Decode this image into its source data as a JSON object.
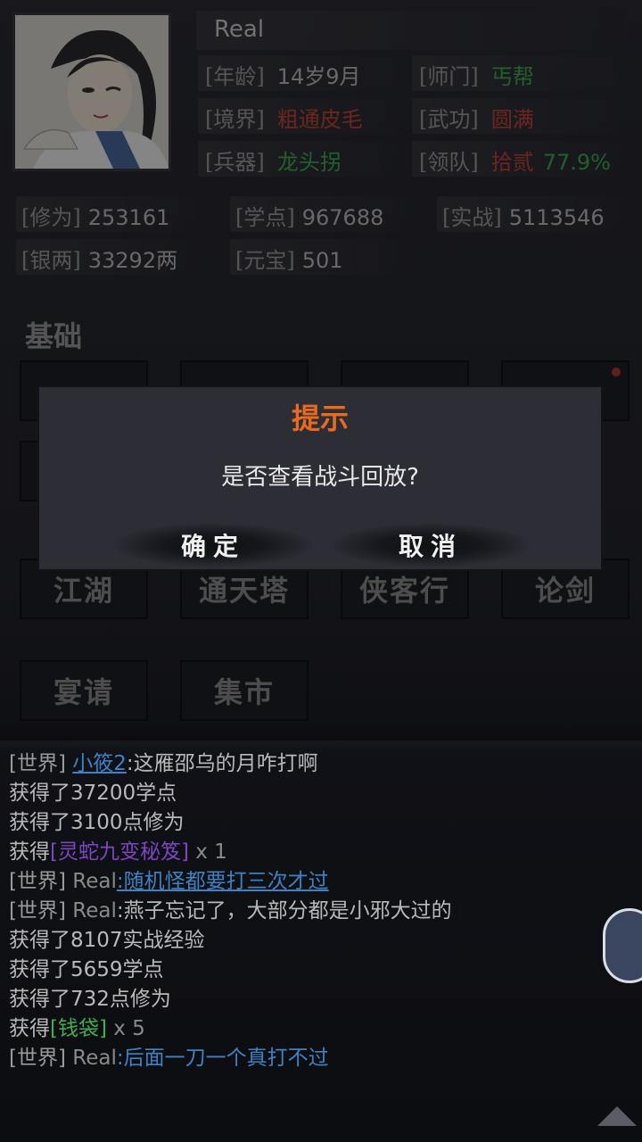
{
  "player": {
    "name": "Real",
    "age_label": "[年龄]",
    "age": "14岁9月",
    "sect_label": "[师门]",
    "sect": "丐帮",
    "realm_label": "[境界]",
    "realm": "粗通皮毛",
    "martial_label": "[武功]",
    "martial": "圆满",
    "weapon_label": "[兵器]",
    "weapon": "龙头拐",
    "lead_label": "[领队]",
    "lead": "拾贰",
    "lead_pct": "77.9%"
  },
  "resources": {
    "cultivation_label": "[修为]",
    "cultivation": "253161",
    "learn_label": "[学点]",
    "learn": "967688",
    "combat_label": "[实战]",
    "combat": "5113546",
    "silver_label": "[银两]",
    "silver": "33292两",
    "ingot_label": "[元宝]",
    "ingot": "501"
  },
  "sections": {
    "basic": "基础"
  },
  "menu": {
    "jianghu": "江湖",
    "tower": "通天塔",
    "xiakexing": "侠客行",
    "lunjian": "论剑",
    "banquet": "宴请",
    "market": "集市"
  },
  "dialog": {
    "title": "提示",
    "message": "是否查看战斗回放?",
    "confirm": "确定",
    "cancel": "取消"
  },
  "log": [
    {
      "tag": "[世界]",
      "user": "小筱2",
      "text": ":这雁邵乌的月咋打啊"
    },
    {
      "text": "获得了37200学点"
    },
    {
      "text": "获得了3100点修为"
    },
    {
      "prefix": "获得",
      "item": "[灵蛇九变秘笈]",
      "count": " x 1"
    },
    {
      "tag": "[世界]",
      "user": "Real",
      "text": ":随机怪都要打三次才过"
    },
    {
      "tag": "[世界]",
      "user": "Real",
      "text": ":燕子忘记了，大部分都是小邪大过的"
    },
    {
      "text": "获得了8107实战经验"
    },
    {
      "text": "获得了5659学点"
    },
    {
      "text": "获得了732点修为"
    },
    {
      "prefix": "获得",
      "item": "[钱袋]",
      "count": " x 5"
    },
    {
      "tag": "[世界]",
      "user": "Real",
      "text": ":后面一刀一个真打不过"
    }
  ],
  "colors": {
    "accent_orange": "#e86a1f",
    "green": "#3fae54",
    "red": "#c2453a",
    "link_blue": "#3f82c4",
    "item_purple": "#7b46c2"
  }
}
